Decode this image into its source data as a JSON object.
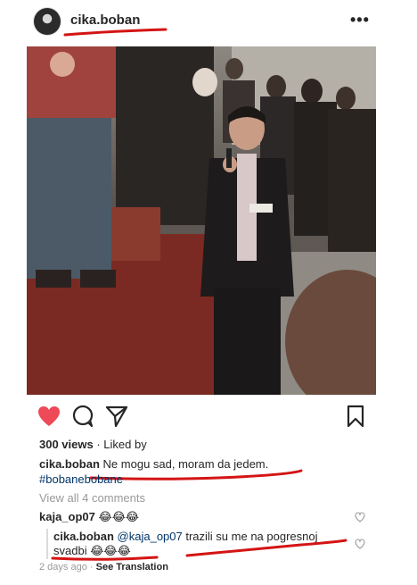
{
  "post": {
    "username": "cika.boban",
    "more_icon": "more-options-icon",
    "views": "300 views",
    "liked_by": " · Liked by",
    "caption_user": "cika.boban",
    "caption_text": "Ne mogu sad, moram da jedem.",
    "hashtag": "#bobanebobane",
    "view_comments": "View all 4 comments",
    "timestamp": "2 days ago",
    "translation_sep": " · ",
    "see_translation": "See Translation"
  },
  "comments": [
    {
      "user": "kaja_op07",
      "text": "😂😂😂"
    },
    {
      "user": "cika.boban",
      "mention": "@kaja_op07",
      "text": " trazili su me na pogresnoj",
      "text2": "svadbi",
      "emoji2": " 😂😂😂"
    }
  ],
  "colors": {
    "like_red": "#ed4956",
    "annotation_red": "#d41414",
    "link_blue": "#003569",
    "muted_gray": "#999999"
  },
  "icons": [
    "heart-icon",
    "comment-icon",
    "share-icon",
    "bookmark-icon",
    "small-heart-icon"
  ]
}
